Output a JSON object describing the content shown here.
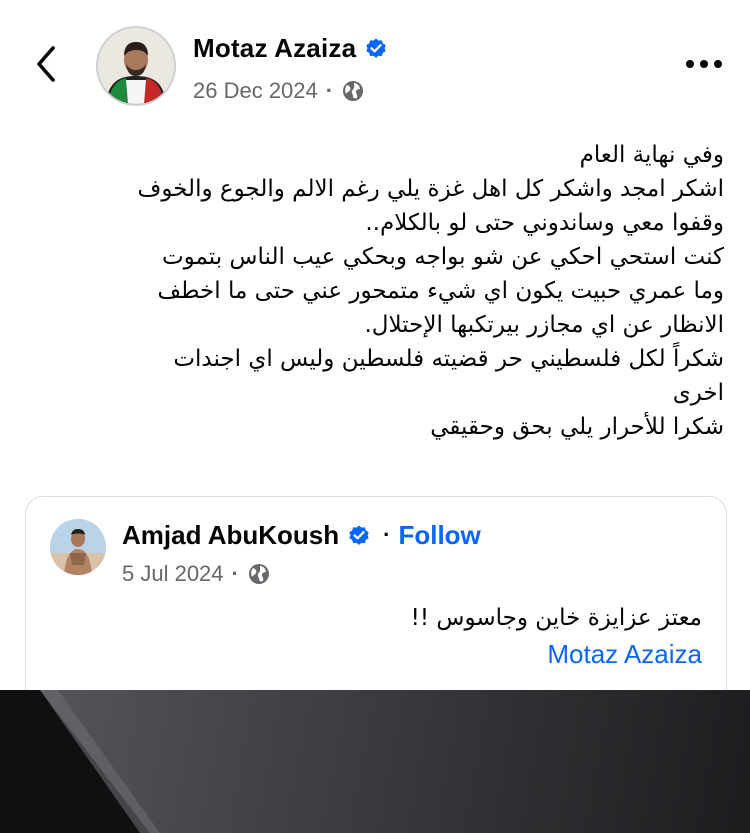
{
  "post": {
    "author_name": "Motaz Azaiza",
    "date": "26 Dec 2024",
    "separator": "·",
    "icons": {
      "back": "chevron-left-icon",
      "verified": "verified-badge-icon",
      "privacy": "globe-icon",
      "more": "more-horizontal-icon"
    },
    "text_lines": [
      "وفي نهاية العام",
      "اشكر امجد واشكر كل اهل غزة يلي رغم الالم والجوع والخوف",
      "وقفوا معي وساندوني حتى لو بالكلام..",
      "كنت استحي احكي عن شو بواجه وبحكي عيب الناس بتموت",
      "وما عمري حبيت يكون اي شيء متمحور عني حتى ما اخطف",
      "الانظار عن اي مجازر بيرتكبها الإحتلال.",
      "شكراً لكل فلسطيني حر قضيته فلسطين وليس اي اجندات",
      "اخرى",
      "شكرا للأحرار يلي بحق وحقيقي"
    ]
  },
  "shared_post": {
    "author_name": "Amjad AbuKoush",
    "follow_label": "Follow",
    "separator": "·",
    "date": "5 Jul 2024",
    "text": "معتز عزايزة خاين وجاسوس !!",
    "mention": "Motaz Azaiza"
  },
  "colors": {
    "link_blue": "#0866ff",
    "verified_blue": "#0866ff",
    "meta_gray": "#65676b",
    "text_dark": "#050505"
  }
}
